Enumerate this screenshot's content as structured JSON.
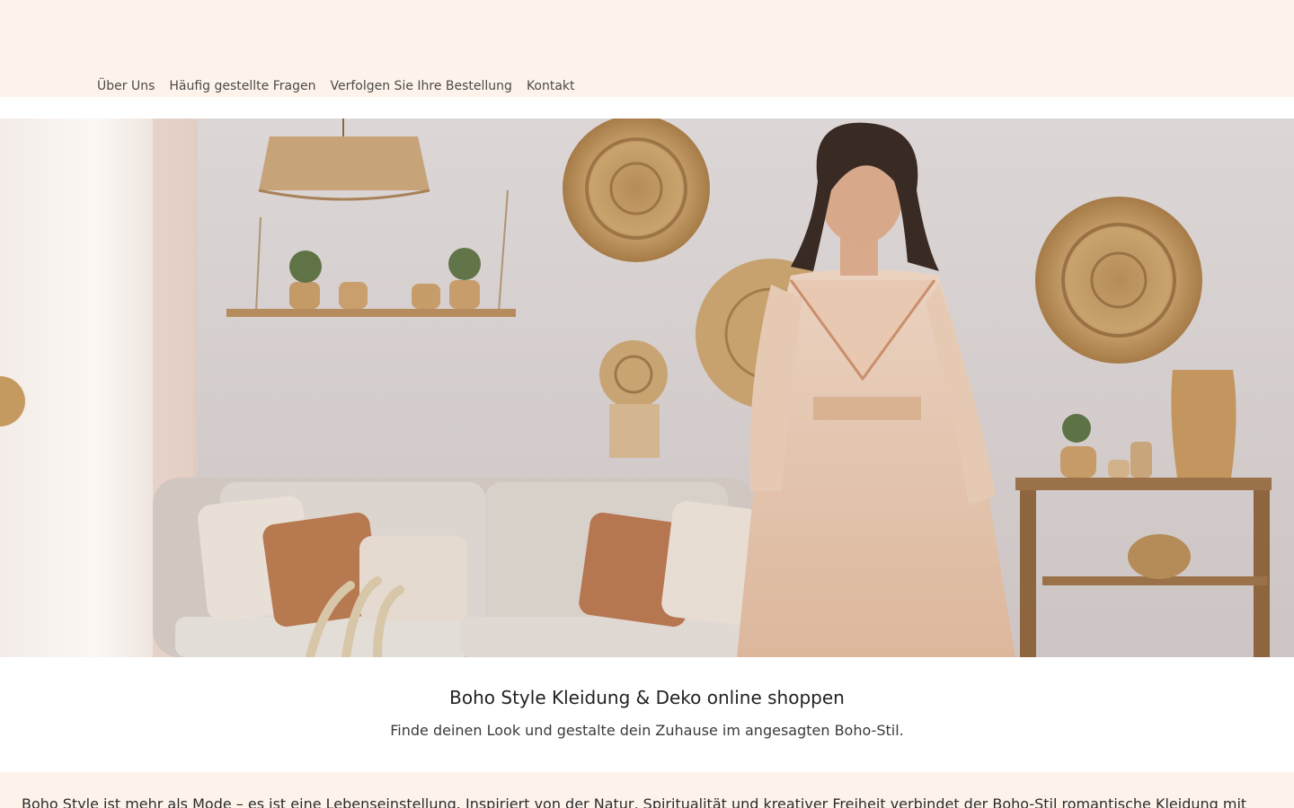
{
  "nav": {
    "items": [
      {
        "label": "Über Uns"
      },
      {
        "label": "Häufig gestellte Fragen"
      },
      {
        "label": "Verfolgen Sie Ihre Bestellung"
      },
      {
        "label": "Kontakt"
      }
    ]
  },
  "intro": {
    "title": "Boho Style Kleidung & Deko online shoppen",
    "subtitle": "Finde deinen Look und gestalte dein Zuhause im angesagten Boho-Stil."
  },
  "story": {
    "text": "Boho Style ist mehr als Mode – es ist eine Lebenseinstellung. Inspiriert von der Natur, Spiritualität und kreativer Freiheit verbindet der Boho-Stil romantische Kleidung mit"
  },
  "colors": {
    "header_bg": "#fdf3ea",
    "story_bg": "#fdf3ea",
    "nav_text": "#4a4a4a"
  }
}
